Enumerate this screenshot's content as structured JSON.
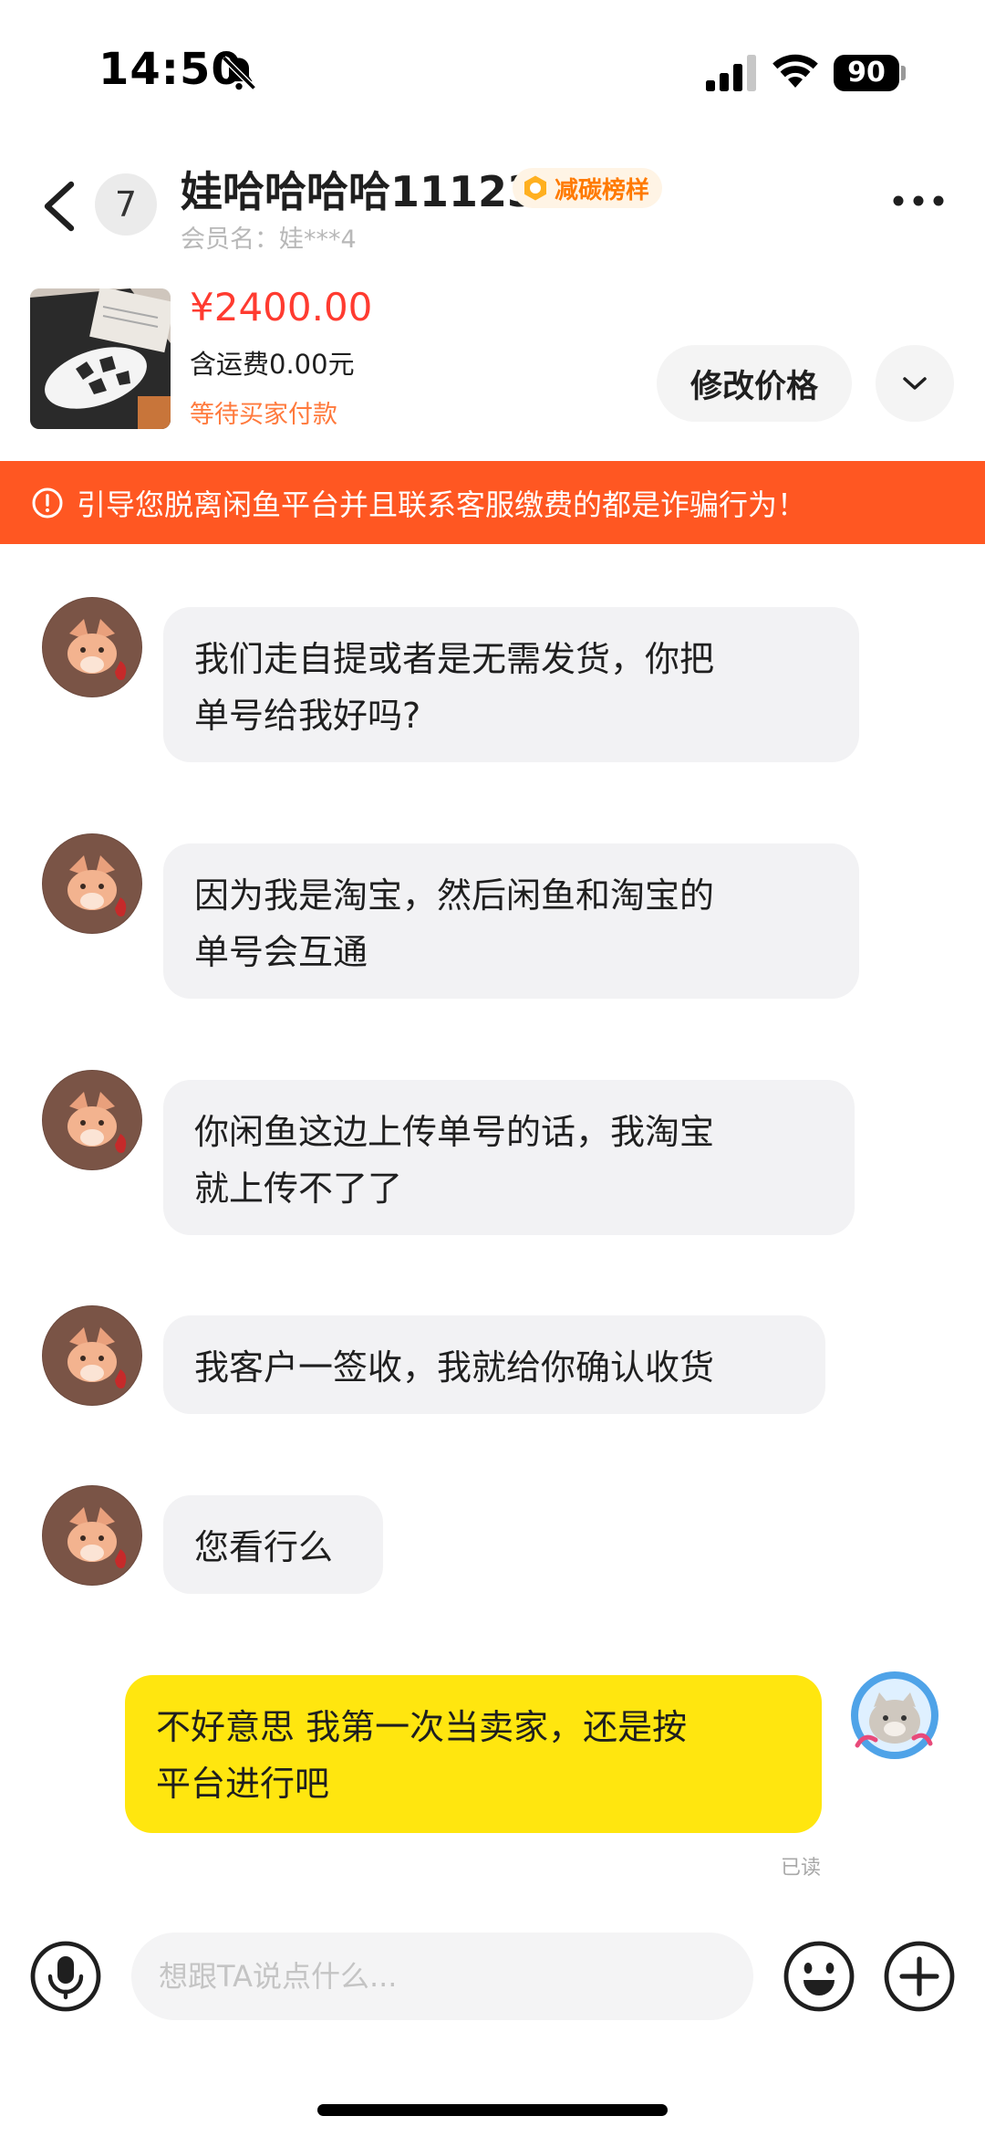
{
  "status_bar": {
    "time": "14:50",
    "battery": "90",
    "icons": [
      "bell-muted-icon",
      "signal-icon",
      "wifi-icon",
      "battery-icon"
    ]
  },
  "header": {
    "back_icon": "chevron-left-icon",
    "unread_count": "7",
    "contact_name": "娃哈哈哈哈11123",
    "badge": "减碳榜样",
    "member_name": "会员名：娃***4",
    "more_icon": "more-dots-icon"
  },
  "product": {
    "price": "¥2400.00",
    "shipping": "含运费0.00元",
    "status": "等待买家付款",
    "edit_price_label": "修改价格",
    "expand_icon": "chevron-down-icon"
  },
  "warning": {
    "icon": "exclamation-circle-icon",
    "text": "引导您脱离闲鱼平台并且联系客服缴费的都是诈骗行为！"
  },
  "messages": [
    {
      "side": "in",
      "text": "我们走自提或者是无需发货，你把\n单号给我好吗?"
    },
    {
      "side": "in",
      "text": "因为我是淘宝，然后闲鱼和淘宝的\n单号会互通"
    },
    {
      "side": "in",
      "text": "你闲鱼这边上传单号的话，我淘宝\n就上传不了了"
    },
    {
      "side": "in",
      "text": "我客户一签收，我就给你确认收货"
    },
    {
      "side": "in",
      "text": "您看行么"
    },
    {
      "side": "out",
      "text": "不好意思 我第一次当卖家，还是按\n平台进行吧"
    }
  ],
  "read_receipt": "已读",
  "input_bar": {
    "placeholder": "想跟TA说点什么...",
    "voice_icon": "microphone-icon",
    "emoji_icon": "emoji-icon",
    "plus_icon": "plus-circle-icon"
  },
  "colors": {
    "warning_banner": "#ff5722",
    "price": "#ff3b30",
    "outgoing_bubble": "#ffe60f",
    "incoming_bubble": "#f2f2f4",
    "badge_text": "#ff7a00"
  }
}
